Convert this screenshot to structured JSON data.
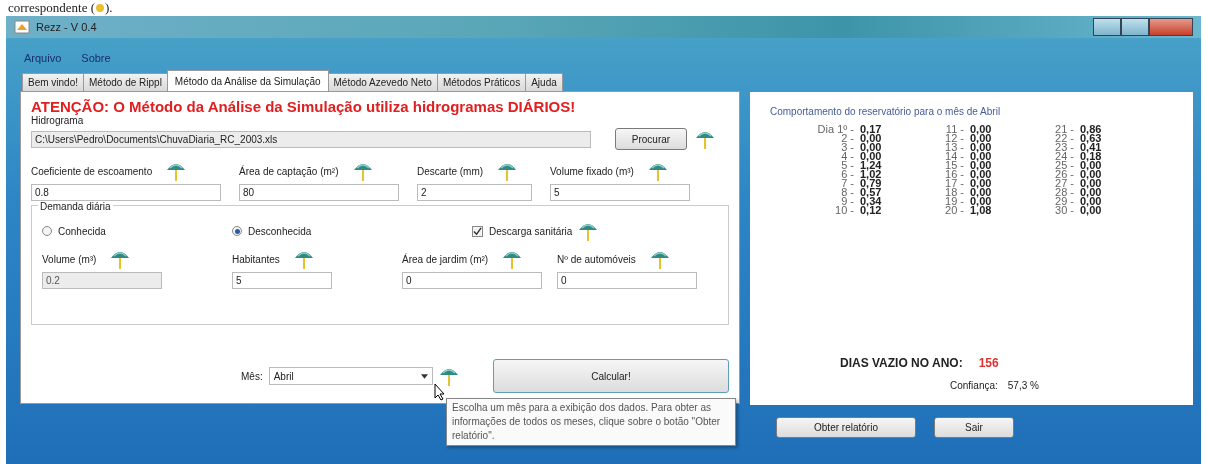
{
  "doc_caption": {
    "before": "correspondente (",
    "after": ")."
  },
  "window": {
    "title": "Rezz - V 0.4"
  },
  "menu": [
    "Arquivo",
    "Sobre"
  ],
  "tabs": [
    {
      "label": "Bem vindo!",
      "selected": false
    },
    {
      "label": "Método de Rippl",
      "selected": false
    },
    {
      "label": "Método da Análise da Simulação",
      "selected": true
    },
    {
      "label": "Método Azevedo Neto",
      "selected": false
    },
    {
      "label": "Métodos Práticos",
      "selected": false
    },
    {
      "label": "Ajuda",
      "selected": false
    }
  ],
  "warning": "ATENÇÃO: O Método da Análise da Simulação utiliza hidrogramas DIÁRIOS!",
  "hydrograph": {
    "label": "Hidrograma",
    "value": "C:\\Users\\Pedro\\Documents\\ChuvaDiaria_RC_2003.xls",
    "button": "Procurar"
  },
  "parameters": [
    {
      "label": "Coeficiente de escoamento",
      "value": "0.8"
    },
    {
      "label": "Área de captação (m²)",
      "value": "80"
    },
    {
      "label": "Descarte (mm)",
      "value": "2"
    },
    {
      "label": "Volume fixado (m³)",
      "value": "5"
    }
  ],
  "demand": {
    "title": "Demanda diária",
    "options": [
      {
        "label": "Conhecida",
        "selected": false
      },
      {
        "label": "Desconhecida",
        "selected": true
      }
    ],
    "sanitary": {
      "label": "Descarga sanitária",
      "checked": true
    },
    "volume": {
      "label": "Volume (m³)",
      "value": "0.2",
      "disabled": true
    },
    "inputs": [
      {
        "label": "Habitantes",
        "value": "5"
      },
      {
        "label": "Área de jardim (m²)",
        "value": "0"
      },
      {
        "label": "Nº de automóveis",
        "value": "0"
      }
    ]
  },
  "month": {
    "label": "Mês:",
    "value": "Abril"
  },
  "calculate_button": "Calcular!",
  "tooltip": "Escolha um mês para a exibição dos dados. Para obter as informações de todos os meses, clique sobre o botão \"Obter relatório\".",
  "results": {
    "title": "Comportamento do reservatório  para o mês de Abril",
    "days": [
      {
        "day": "Dia 1º -",
        "value": "0,17"
      },
      {
        "day": "2 -",
        "value": "0,00"
      },
      {
        "day": "3 -",
        "value": "0,00"
      },
      {
        "day": "4 -",
        "value": "0,00"
      },
      {
        "day": "5 -",
        "value": "1,24"
      },
      {
        "day": "6 -",
        "value": "1,02"
      },
      {
        "day": "7 -",
        "value": "0,79"
      },
      {
        "day": "8 -",
        "value": "0,57"
      },
      {
        "day": "9 -",
        "value": "0,34"
      },
      {
        "day": "10 -",
        "value": "0,12"
      },
      {
        "day": "11 -",
        "value": "0,00"
      },
      {
        "day": "12 -",
        "value": "0,00"
      },
      {
        "day": "13 -",
        "value": "0,00"
      },
      {
        "day": "14 -",
        "value": "0,00"
      },
      {
        "day": "15 -",
        "value": "0,00"
      },
      {
        "day": "16 -",
        "value": "0,00"
      },
      {
        "day": "17 -",
        "value": "0,00"
      },
      {
        "day": "18 -",
        "value": "0,00"
      },
      {
        "day": "19 -",
        "value": "0,00"
      },
      {
        "day": "20 -",
        "value": "1,08"
      },
      {
        "day": "21 -",
        "value": "0,86"
      },
      {
        "day": "22 -",
        "value": "0,63"
      },
      {
        "day": "23 -",
        "value": "0,41"
      },
      {
        "day": "24 -",
        "value": "0,18"
      },
      {
        "day": "25 -",
        "value": "0,00"
      },
      {
        "day": "26 -",
        "value": "0,00"
      },
      {
        "day": "27 -",
        "value": "0,00"
      },
      {
        "day": "28 -",
        "value": "0,00"
      },
      {
        "day": "29 -",
        "value": "0,00"
      },
      {
        "day": "30 -",
        "value": "0,00"
      }
    ],
    "empty_days_label": "DIAS VAZIO NO ANO:",
    "empty_days": "156",
    "confidence_label": "Confiança:",
    "confidence": "57,3 %"
  },
  "buttons": [
    "Obter relatório",
    "Sair"
  ]
}
